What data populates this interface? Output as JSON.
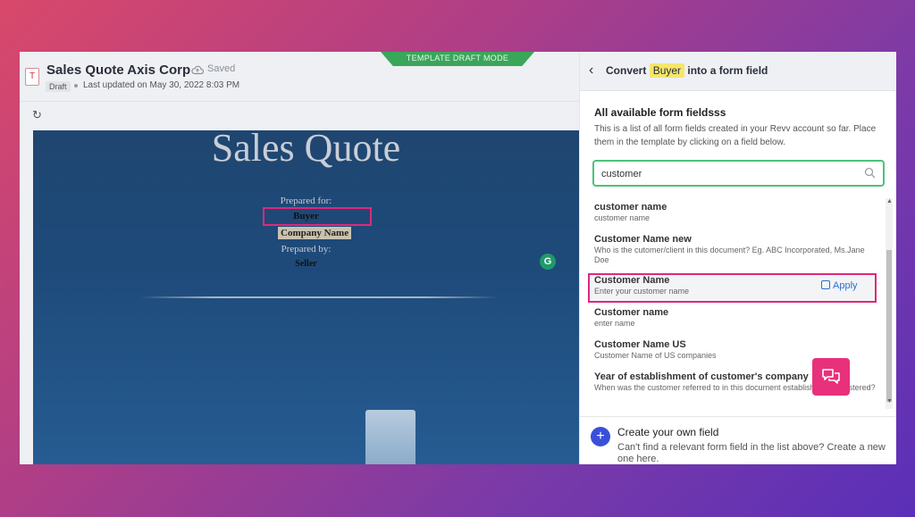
{
  "editor": {
    "doc_title": "Sales Quote Axis Corp",
    "saved_label": "Saved",
    "draft_badge": "Draft",
    "last_updated": "Last updated on May 30, 2022 8:03 PM",
    "mode_banner": "TEMPLATE DRAFT MODE",
    "doc_icon_letter": "T"
  },
  "document": {
    "title": "Sales Quote",
    "prepared_for": "Prepared for:",
    "buyer": "Buyer",
    "company_name": "Company Name",
    "prepared_by": "Prepared by:",
    "seller": "Seller",
    "grammarly_letter": "G"
  },
  "panel": {
    "header_prefix": "Convert",
    "header_highlight": "Buyer",
    "header_suffix": "into a form field",
    "section_title": "All available form fieldsss",
    "section_desc": "This is a list of all form fields created in your Revv account so far. Place them in the template by clicking on a field below.",
    "search_value": "customer",
    "apply_label": "Apply",
    "items": [
      {
        "name": "customer name",
        "desc": "customer name"
      },
      {
        "name": "Customer Name new",
        "desc": "Who is the cutomer/client in this document? Eg. ABC Incorporated, Ms.Jane Doe"
      },
      {
        "name": "Customer Name",
        "desc": "Enter your customer name"
      },
      {
        "name": "Customer name",
        "desc": "enter name"
      },
      {
        "name": "Customer Name US",
        "desc": "Customer Name of US companies"
      },
      {
        "name": "Year of establishment of customer's company",
        "desc": "When was the customer referred to in this document established or registered?"
      }
    ],
    "create_title": "Create your own field",
    "create_desc": "Can't find a relevant form field in the list above? Create a new one here."
  },
  "colors": {
    "accent_pink": "#e0287a",
    "search_border": "#4cc27a",
    "banner_green": "#3aa65a",
    "plus_blue": "#3a4fd9",
    "highlight_yellow": "#f5e66a"
  },
  "icons": [
    "doc-icon",
    "cloud-icon",
    "refresh-icon",
    "back-icon",
    "search-icon",
    "copy-icon",
    "plus-icon",
    "chat-icon",
    "grammarly-icon"
  ]
}
